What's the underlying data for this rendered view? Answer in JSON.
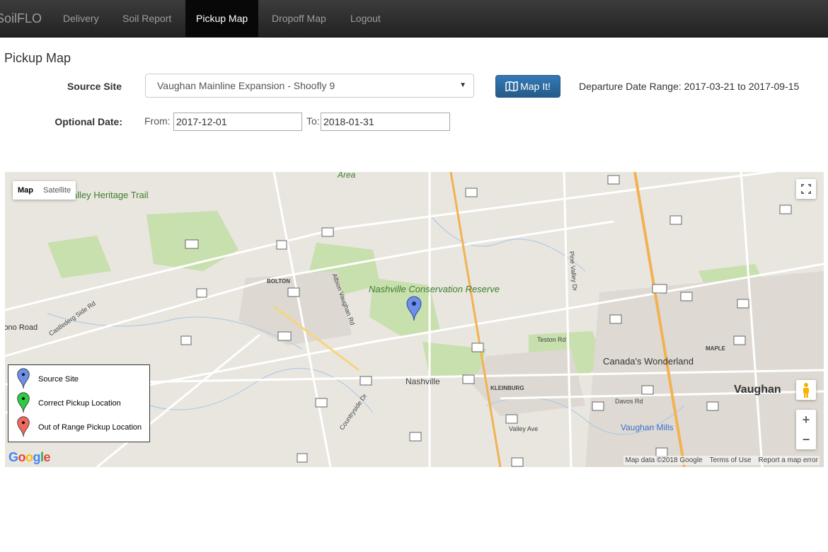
{
  "nav": {
    "brand": "SoilFLO",
    "items": [
      {
        "label": "Delivery",
        "active": false
      },
      {
        "label": "Soil Report",
        "active": false
      },
      {
        "label": "Pickup Map",
        "active": true
      },
      {
        "label": "Dropoff Map",
        "active": false
      },
      {
        "label": "Logout",
        "active": false
      }
    ]
  },
  "page_title": "Pickup Map",
  "form": {
    "source_site_label": "Source Site",
    "source_site_value": "Vaughan Mainline Expansion - Shoofly 9",
    "map_button_label": "Map It!",
    "departure_range": "Departure Date Range: 2017-03-21 to 2017-09-15",
    "optional_date_label": "Optional Date:",
    "from_label": "From:",
    "from_value": "2017-12-01",
    "to_label": "To:",
    "to_value": "2018-01-31"
  },
  "map": {
    "type_map": "Map",
    "type_satellite": "Satellite",
    "zoom_in": "+",
    "zoom_out": "−",
    "google_logo": "Google",
    "footer_data": "Map data ©2018 Google",
    "footer_terms": "Terms of Use",
    "footer_report": "Report a map error",
    "labels": {
      "nashville_conservation": "Nashville Conservation Reserve",
      "nashville": "Nashville",
      "bolton": "BOLTON",
      "kleinburg": "KLEINBURG",
      "maple": "MAPLE",
      "vaughan": "Vaughan",
      "canadas_wonderland": "Canada's Wonderland",
      "vaughan_mills": "Vaughan Mills",
      "heritage_trail": "er Valley Heritage Trail",
      "mono_road": "lono Road",
      "area": "Area",
      "teston_rd": "Teston Rd",
      "davos_rd": "Davos Rd",
      "valley_ave": "Valley Ave",
      "countryside_dr": "Countryside Dr",
      "albion_vaughan_rd": "Albion Vaughan Rd",
      "castlederg_side_rd": "Castlederg Side Rd",
      "pine_valley_dr": "Pine Valley Dr"
    },
    "legend": [
      {
        "label": "Source Site",
        "color": "#6d8fe8"
      },
      {
        "label": "Correct Pickup Location",
        "color": "#2ecc40"
      },
      {
        "label": "Out of Range Pickup Location",
        "color": "#f0695f"
      }
    ]
  },
  "colors": {
    "navbar": "#222222",
    "primary_button": "#337ab7",
    "park": "#c8dfae",
    "highway": "#f2b252"
  }
}
